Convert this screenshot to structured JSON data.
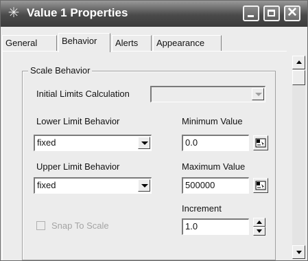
{
  "window": {
    "title": "Value 1 Properties",
    "icon": "asterisk-icon",
    "controls": [
      "minimize-icon",
      "maximize-icon",
      "close-icon"
    ]
  },
  "tabs": [
    {
      "label": "General",
      "active": false
    },
    {
      "label": "Behavior",
      "active": true
    },
    {
      "label": "Alerts",
      "active": false
    },
    {
      "label": "Appearance",
      "active": false
    }
  ],
  "group": {
    "legend": "Scale Behavior",
    "initial_limits": {
      "label": "Initial Limits Calculation",
      "value": ""
    },
    "lower_limit": {
      "label": "Lower Limit Behavior",
      "value": "fixed"
    },
    "minimum": {
      "label": "Minimum Value",
      "value": "0.0"
    },
    "upper_limit": {
      "label": "Upper Limit Behavior",
      "value": "fixed"
    },
    "maximum": {
      "label": "Maximum Value",
      "value": "500000"
    },
    "increment": {
      "label": "Increment",
      "value": "1.0"
    },
    "snap": {
      "label": "Snap To Scale",
      "checked": false
    }
  }
}
